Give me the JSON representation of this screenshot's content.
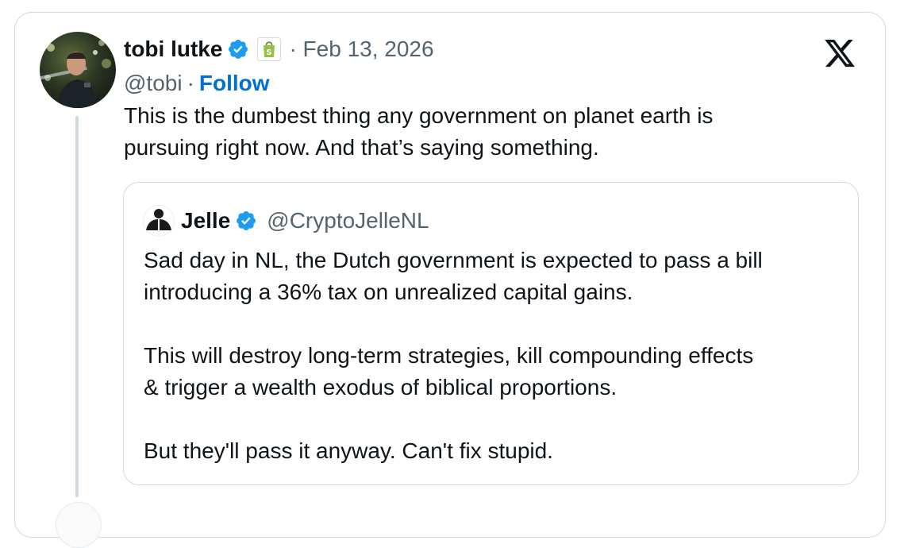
{
  "tweet": {
    "author_name": "tobi lutke",
    "handle": "@tobi",
    "separator": "·",
    "follow_label": "Follow",
    "date": "· Feb 13, 2026",
    "verified_icon": "verified-badge-icon",
    "affiliate_icon": "shopify-bag-icon",
    "text_lines": [
      "This is the dumbest thing any government on planet earth is",
      "pursuing right now. And that’s saying something."
    ]
  },
  "quote": {
    "author_name": "Jelle",
    "handle": "@CryptoJelleNL",
    "paragraphs": [
      [
        "Sad day in NL, the Dutch government is expected to pass a bill",
        "introducing a 36% tax on unrealized capital gains."
      ],
      [
        "This will destroy long-term strategies, kill compounding effects",
        "& trigger a wealth exodus of biblical proportions."
      ],
      [
        "But they'll pass it anyway. Can't fix stupid."
      ]
    ]
  },
  "colors": {
    "verified_blue": "#1d9bf0",
    "link_blue": "#006fd6",
    "muted": "#536471",
    "border": "#cfd9de",
    "shopify_green": "#95bf47"
  }
}
